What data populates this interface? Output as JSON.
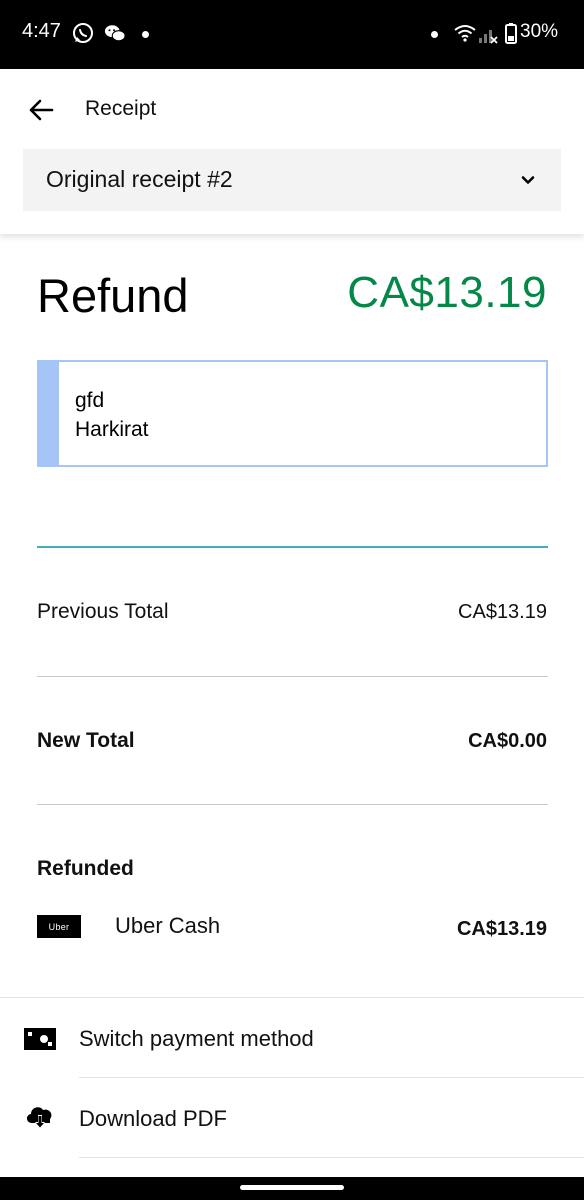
{
  "status_bar": {
    "time": "4:47",
    "battery_pct": "30%",
    "icons": [
      "whatsapp-icon",
      "wechat-icon",
      "notification-dot",
      "wifi-icon",
      "signal-icon",
      "battery-icon"
    ]
  },
  "header": {
    "back_icon": "arrow-left-icon",
    "title": "Receipt",
    "receipt_select": {
      "value": "Original receipt #2",
      "icon": "chevron-down-icon"
    }
  },
  "refund": {
    "title": "Refund",
    "amount": "CA$13.19",
    "amount_color": "#048848"
  },
  "note": {
    "lines": [
      "gfd",
      "Harkirat"
    ],
    "accent_color": "#a6c5f7"
  },
  "totals": {
    "previous": {
      "label": "Previous Total",
      "value": "CA$13.19"
    },
    "new": {
      "label": "New Total",
      "value": "CA$0.00"
    }
  },
  "refunded": {
    "heading": "Refunded",
    "method": {
      "logo_text": "Uber",
      "label": "Uber Cash",
      "amount": "CA$13.19"
    }
  },
  "actions": [
    {
      "label": "Switch payment method",
      "icon": "payment-card-icon"
    },
    {
      "label": "Download PDF",
      "icon": "cloud-download-icon"
    }
  ]
}
